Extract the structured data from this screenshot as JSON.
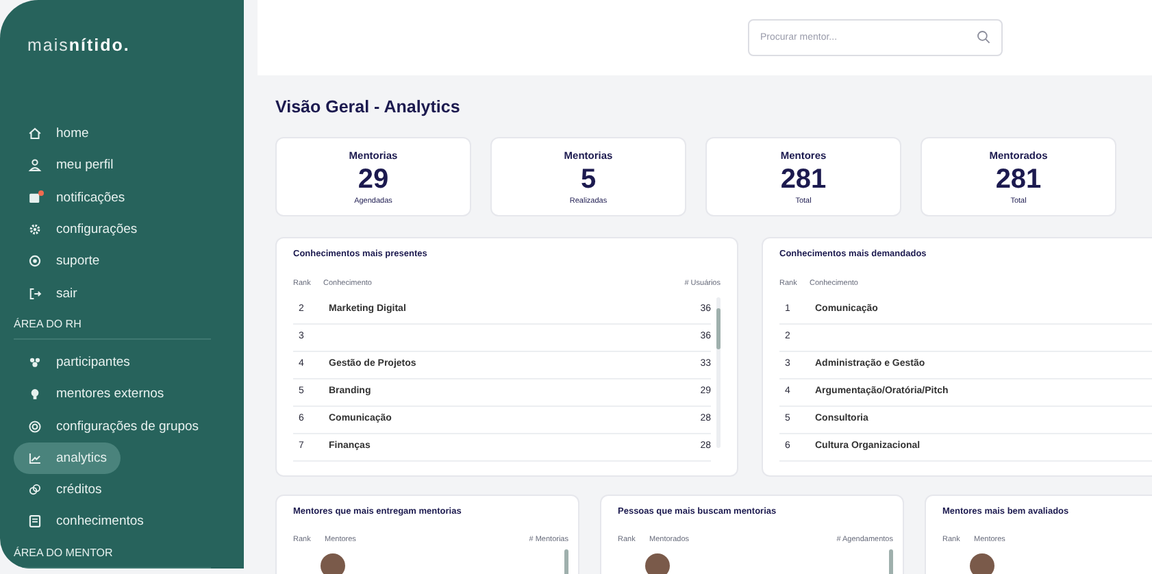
{
  "sidebar": {
    "logo": {
      "light": "mais",
      "bold": "nítido."
    },
    "sections": [
      {
        "items": [
          {
            "label": "home",
            "selected": false,
            "alert": false
          },
          {
            "label": "meu perfil",
            "selected": false,
            "alert": false
          },
          {
            "label": "notificações",
            "selected": false,
            "alert": true
          },
          {
            "label": "configurações",
            "selected": false,
            "alert": false
          },
          {
            "label": "suporte",
            "selected": false,
            "alert": false
          },
          {
            "label": "sair",
            "selected": false,
            "alert": false
          }
        ]
      },
      {
        "heading": "ÁREA DO RH",
        "items": [
          {
            "label": "participantes",
            "selected": false,
            "alert": false
          },
          {
            "label": "mentores externos",
            "selected": false,
            "alert": false
          },
          {
            "label": "configurações de grupos",
            "selected": false,
            "alert": false
          },
          {
            "label": "analytics",
            "selected": true,
            "alert": false
          },
          {
            "label": "créditos",
            "selected": false,
            "alert": false
          },
          {
            "label": "conhecimentos",
            "selected": false,
            "alert": false
          }
        ]
      },
      {
        "heading": "ÁREA DO MENTOR"
      }
    ]
  },
  "top_bar": {
    "search": {
      "placeholder": "Procurar mentor..."
    }
  },
  "page_title": "Visão Geral - Analytics",
  "stats": [
    {
      "label": "Mentorias",
      "value": "29",
      "caption": "Agendadas"
    },
    {
      "label": "Mentorias",
      "value": "5",
      "caption": "Realizadas"
    },
    {
      "label": "Mentores",
      "value": "281",
      "caption": "Total"
    },
    {
      "label": "Mentorados",
      "value": "281",
      "caption": "Total"
    }
  ],
  "tables": [
    {
      "title": "Conhecimentos mais presentes",
      "columns": [
        "Rank",
        "Conhecimento",
        "# Usuários"
      ],
      "scrollbar": true,
      "rows": [
        {
          "rank": "2",
          "name": "Marketing Digital",
          "count": "36"
        },
        {
          "rank": "3",
          "count": "36"
        },
        {
          "rank": "4",
          "name": "Gestão de Projetos",
          "count": "33"
        },
        {
          "rank": "5",
          "name": "Branding",
          "count": "29"
        },
        {
          "rank": "6",
          "name": "Comunicação",
          "count": "28"
        },
        {
          "rank": "7",
          "name": "Finanças",
          "count": "28"
        }
      ]
    },
    {
      "title": "Conhecimentos mais demandados",
      "columns": [
        "Rank",
        "Conhecimento"
      ],
      "scrollbar": false,
      "rows": [
        {
          "rank": "1",
          "name": "Comunicação"
        },
        {
          "rank": "2"
        },
        {
          "rank": "3",
          "name": "Administração e Gestão"
        },
        {
          "rank": "4",
          "name": "Argumentação/Oratória/Pitch"
        },
        {
          "rank": "5",
          "name": "Consultoria"
        },
        {
          "rank": "6",
          "name": "Cultura Organizacional"
        }
      ]
    }
  ],
  "people_cards": [
    {
      "title": "Mentores que mais entregam mentorias",
      "columns": [
        "Rank",
        "Mentores",
        "# Mentorias"
      ],
      "scrollbar": true
    },
    {
      "title": "Pessoas que mais buscam mentorias",
      "columns": [
        "Rank",
        "Mentorados",
        "# Agendamentos"
      ],
      "scrollbar": true
    },
    {
      "title": "Mentores mais bem avaliados",
      "columns": [
        "Rank",
        "Mentores"
      ],
      "scrollbar": false
    }
  ]
}
